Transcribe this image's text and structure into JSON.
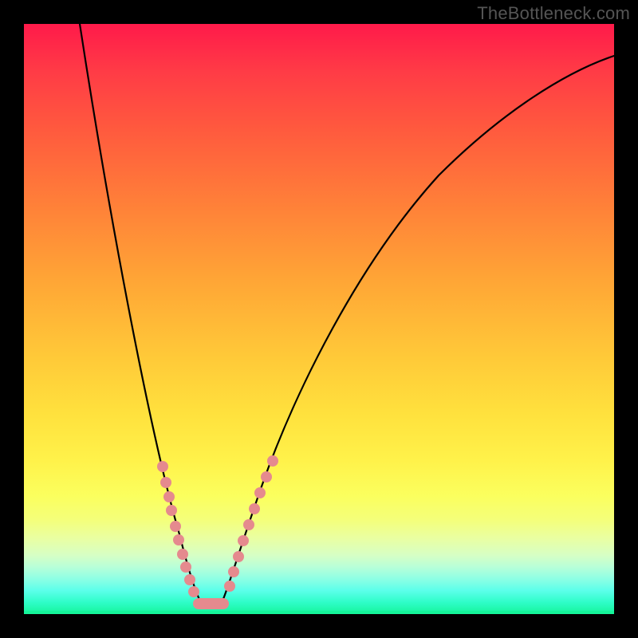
{
  "watermark": "TheBottleneck.com",
  "chart_data": {
    "type": "line",
    "title": "",
    "xlabel": "",
    "ylabel": "",
    "xlim": [
      0,
      100
    ],
    "ylim": [
      0,
      100
    ],
    "background_gradient": {
      "orientation": "vertical",
      "stops": [
        {
          "pos": 0.0,
          "color": "#ff1a4a"
        },
        {
          "pos": 0.5,
          "color": "#ffc838"
        },
        {
          "pos": 0.8,
          "color": "#fbff5e"
        },
        {
          "pos": 1.0,
          "color": "#15f59a"
        }
      ]
    },
    "series": [
      {
        "name": "bottleneck_curve",
        "color": "#000000",
        "x": [
          9,
          12,
          15,
          18,
          21,
          24,
          27,
          29,
          30.5,
          32,
          34,
          37,
          41,
          46,
          52,
          60,
          70,
          82,
          94,
          100
        ],
        "y": [
          100,
          80,
          62,
          46,
          32,
          20,
          12,
          5,
          2,
          2,
          5,
          12,
          24,
          38,
          52,
          66,
          78,
          87,
          93,
          95
        ]
      }
    ],
    "markers": {
      "color": "#e58a8e",
      "left_cluster": {
        "x": [
          23.5,
          24,
          24.6,
          25,
          25.7,
          26.2,
          26.9,
          27.4,
          28.1,
          28.8
        ],
        "y": [
          25,
          22.3,
          19.9,
          17.6,
          14.9,
          12.6,
          10.1,
          8.0,
          5.8,
          3.8
        ]
      },
      "right_cluster": {
        "x": [
          34.9,
          35.5,
          36.4,
          37.2,
          38.1,
          39.1,
          40.0,
          41.1,
          42.2
        ],
        "y": [
          4.7,
          7.2,
          9.7,
          12.4,
          15.1,
          17.8,
          20.5,
          23.2,
          25.9
        ]
      },
      "gully": {
        "x": [
          29.6,
          33.8
        ],
        "y": [
          1.8,
          1.8
        ]
      }
    }
  }
}
